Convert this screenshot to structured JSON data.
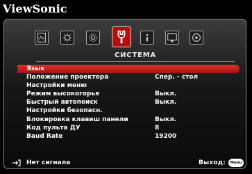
{
  "brand": "ViewSonic",
  "section_title": "СИСТЕМА",
  "tabs": [
    {
      "name": "picture-icon"
    },
    {
      "name": "image-settings-icon"
    },
    {
      "name": "advanced-icon"
    },
    {
      "name": "system-icon",
      "active": true
    },
    {
      "name": "info-icon"
    },
    {
      "name": "display-icon"
    },
    {
      "name": "audio-icon"
    }
  ],
  "menu": [
    {
      "label": "Язык",
      "value": ""
    },
    {
      "label": "Положение проектора",
      "value": "Спер. - стол"
    },
    {
      "label": "Настройки меню",
      "value": ""
    },
    {
      "label": "Режим высокогорья",
      "value": "Выкл."
    },
    {
      "label": "Быстрый автопоиск",
      "value": "Выкл."
    },
    {
      "label": "Настройки безопасн.",
      "value": ""
    },
    {
      "label": "Блокировка клавиш панели",
      "value": "Выкл."
    },
    {
      "label": "Код пульта ДУ",
      "value": "8"
    },
    {
      "label": "Baud Rate",
      "value": "19200"
    }
  ],
  "footer": {
    "signal": "Нет сигнала",
    "exit": "Выход:",
    "menu_button": "Menu"
  },
  "colors": {
    "accent": "#b40f0f",
    "highlight": "#d8322c"
  }
}
